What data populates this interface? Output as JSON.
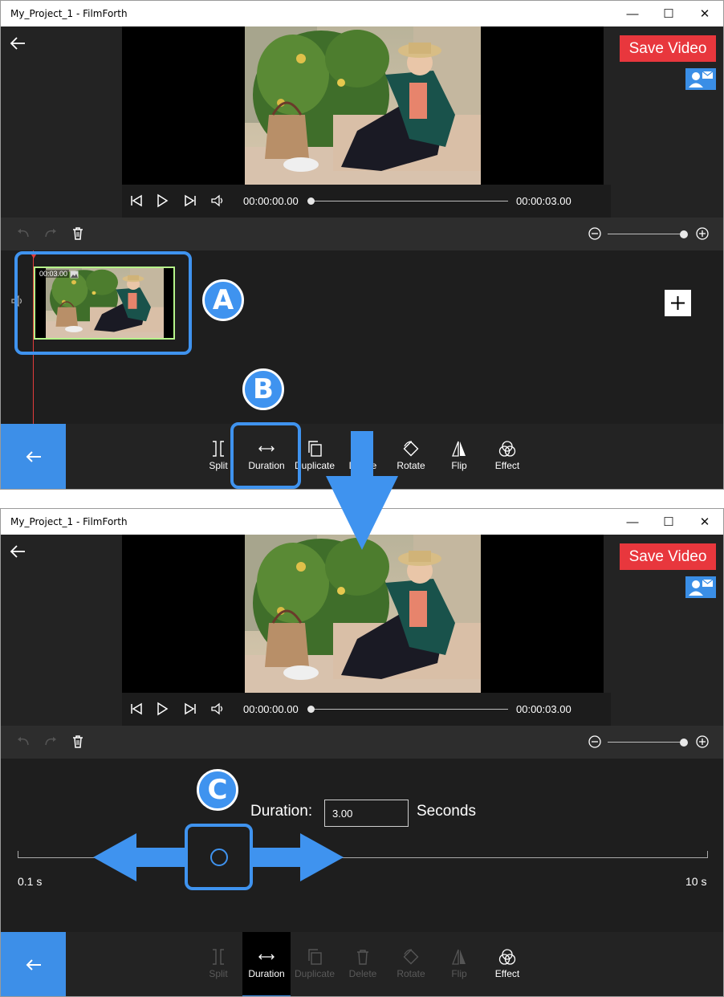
{
  "window_title": "My_Project_1 - FilmForth",
  "window_controls": {
    "minimize": "—",
    "maximize": "☐",
    "close": "✕"
  },
  "save_label": "Save Video",
  "player": {
    "current_time": "00:00:00.00",
    "total_time": "00:00:03.00",
    "progress": 0
  },
  "clip": {
    "duration_tag": "00:03.00"
  },
  "zoom_level": 1.0,
  "tools": [
    {
      "label": "Split",
      "icon": "split-icon"
    },
    {
      "label": "Duration",
      "icon": "duration-icon"
    },
    {
      "label": "Duplicate",
      "icon": "duplicate-icon"
    },
    {
      "label": "Delete",
      "icon": "delete-icon"
    },
    {
      "label": "Rotate",
      "icon": "rotate-icon"
    },
    {
      "label": "Flip",
      "icon": "flip-icon"
    },
    {
      "label": "Effect",
      "icon": "effect-icon"
    }
  ],
  "duration_panel": {
    "label": "Duration:",
    "value": "3.00",
    "unit": "Seconds",
    "min_label": "0.1 s",
    "max_label": "10 s"
  },
  "callouts": {
    "a": "A",
    "b": "B",
    "c": "C"
  },
  "colors": {
    "accent_blue": "#3f93ef",
    "save_red": "#e8373d",
    "clip_border": "#b6f58a",
    "playhead": "#e23c3c"
  }
}
